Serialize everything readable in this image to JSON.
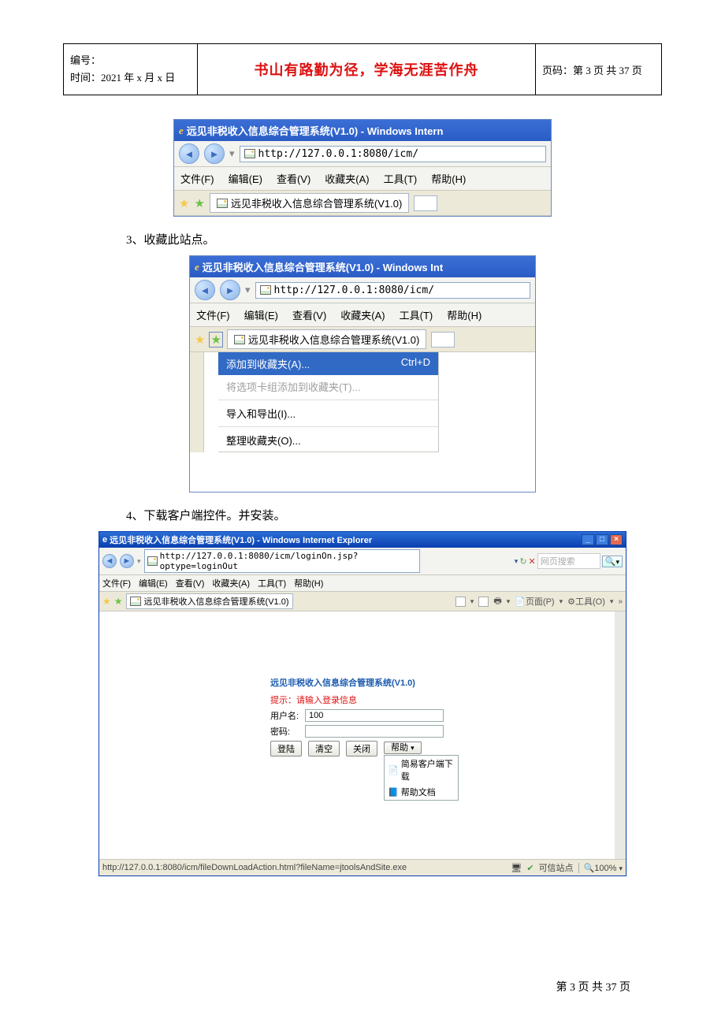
{
  "header": {
    "serial_label": "编号：",
    "time_label": "时间：2021 年 x 月 x 日",
    "center_text": "书山有路勤为径，学海无涯苦作舟",
    "page_label": "页码：第 3 页 共 37 页"
  },
  "items": {
    "step3": "3、收藏此站点。",
    "step4": "4、下载客户端控件。并安装。"
  },
  "ie1": {
    "title": "远见非税收入信息综合管理系统(V1.0) - Windows Intern",
    "url": "http://127.0.0.1:8080/icm/",
    "menus": {
      "file": "文件(F)",
      "edit": "编辑(E)",
      "view": "查看(V)",
      "fav": "收藏夹(A)",
      "tool": "工具(T)",
      "help": "帮助(H)"
    },
    "tab_label": "远见非税收入信息综合管理系统(V1.0)"
  },
  "ie2": {
    "title": "远见非税收入信息综合管理系统(V1.0) - Windows Int",
    "url": "http://127.0.0.1:8080/icm/",
    "tab_label": "远见非税收入信息综合管理系统(V1.0)",
    "dropdown": {
      "add": "添加到收藏夹(A)...",
      "add_shortcut": "Ctrl+D",
      "add_group": "将选项卡组添加到收藏夹(T)...",
      "import_export": "导入和导出(I)...",
      "organize": "整理收藏夹(O)..."
    }
  },
  "ie3": {
    "title": "远见非税收入信息综合管理系统(V1.0) - Windows Internet Explorer",
    "url": "http://127.0.0.1:8080/icm/loginOn.jsp?optype=loginOut",
    "search_placeholder": "网页搜索",
    "tab_label": "远见非税收入信息综合管理系统(V1.0)",
    "toolbar_right": {
      "page": "页面(P)",
      "tools": "工具(O)"
    },
    "login": {
      "title": "远见非税收入信息综合管理系统(V1.0)",
      "hint": "提示：请输入登录信息",
      "user_label": "用户名:",
      "user_value": "100",
      "pass_label": "密码:",
      "pass_value": "",
      "btn_login": "登陆",
      "btn_clear": "清空",
      "btn_close": "关闭",
      "btn_help": "帮助",
      "help_menu_1": "简易客户端下载",
      "help_menu_2": "帮助文档"
    },
    "status_url": "http://127.0.0.1:8080/icm/fileDownLoadAction.html?fileName=jtoolsAndSite.exe",
    "status_trusted": "可信站点",
    "status_zoom": "100%"
  },
  "footer": "第 3 页 共 37 页"
}
